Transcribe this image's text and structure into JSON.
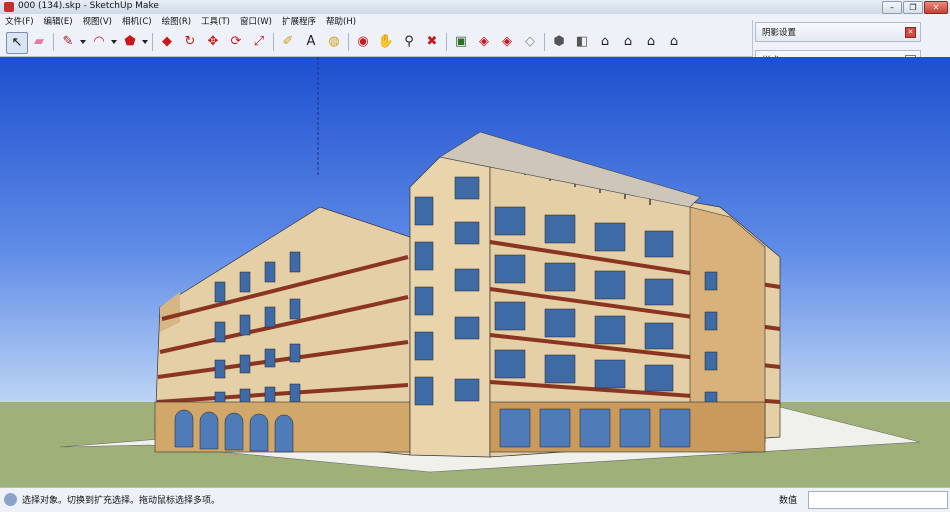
{
  "window": {
    "title": "000 (134).skp - SketchUp Make",
    "minimize_glyph": "–",
    "maximize_glyph": "❐",
    "close_glyph": "✕"
  },
  "menu": [
    "文件(F)",
    "编辑(E)",
    "视图(V)",
    "相机(C)",
    "绘图(R)",
    "工具(T)",
    "窗口(W)",
    "扩展程序",
    "帮助(H)"
  ],
  "toolbar": {
    "tools": [
      {
        "name": "select-icon",
        "glyph": "↖",
        "color": "#111111",
        "active": true
      },
      {
        "name": "eraser-icon",
        "glyph": "▰",
        "color": "#e27aa2"
      },
      {
        "name": "pencil-icon",
        "glyph": "✎",
        "color": "#b0131a",
        "dropdown": true
      },
      {
        "name": "arc-icon",
        "glyph": "◠",
        "color": "#c8191f",
        "dropdown": true
      },
      {
        "name": "shape-icon",
        "glyph": "⬟",
        "color": "#c8191f",
        "dropdown": true
      },
      {
        "name": "push-pull-icon",
        "glyph": "◆",
        "color": "#c8191f"
      },
      {
        "name": "follow-me-icon",
        "glyph": "↻",
        "color": "#c8191f"
      },
      {
        "name": "move-icon",
        "glyph": "✥",
        "color": "#c8191f"
      },
      {
        "name": "rotate-icon",
        "glyph": "⟳",
        "color": "#c8191f"
      },
      {
        "name": "scale-icon",
        "glyph": "⤢",
        "color": "#c8191f"
      },
      {
        "name": "tape-measure-icon",
        "glyph": "✐",
        "color": "#c9a21b"
      },
      {
        "name": "text-icon",
        "glyph": "A",
        "color": "#222222"
      },
      {
        "name": "paint-bucket-icon",
        "glyph": "◍",
        "color": "#c9a21b"
      },
      {
        "name": "orbit-icon",
        "glyph": "◉",
        "color": "#c8191f"
      },
      {
        "name": "pan-icon",
        "glyph": "✋",
        "color": "#444444"
      },
      {
        "name": "zoom-icon",
        "glyph": "⚲",
        "color": "#222222"
      },
      {
        "name": "zoom-extents-icon",
        "glyph": "✖",
        "color": "#c8191f"
      },
      {
        "name": "warehouse-icon",
        "glyph": "▣",
        "color": "#2f6b2f"
      },
      {
        "name": "share-model-icon",
        "glyph": "◈",
        "color": "#c8191f"
      },
      {
        "name": "component-share-icon",
        "glyph": "◈",
        "color": "#c8191f"
      },
      {
        "name": "extension-warehouse-icon",
        "glyph": "◇",
        "color": "#888888"
      },
      {
        "name": "iso-view-icon",
        "glyph": "⬢",
        "color": "#555555"
      },
      {
        "name": "top-view-icon",
        "glyph": "◧",
        "color": "#555555"
      },
      {
        "name": "front-view-icon",
        "glyph": "⌂",
        "color": "#222222"
      },
      {
        "name": "right-view-icon",
        "glyph": "⌂",
        "color": "#222222"
      },
      {
        "name": "back-view-icon",
        "glyph": "⌂",
        "color": "#222222"
      },
      {
        "name": "left-view-icon",
        "glyph": "⌂",
        "color": "#222222"
      }
    ]
  },
  "tray": {
    "shadow_panel": "阴影设置",
    "style_panel": "样式",
    "close_glyph": "✕",
    "expand_glyph": "▢"
  },
  "status": {
    "hint": "选择对象。切换到扩充选择。拖动鼠标选择多项。",
    "value_label": "数值",
    "value": ""
  },
  "colors": {
    "sky_top": "#1d4fcf",
    "ground": "#9fb179",
    "wall_beige": "#e3cda4",
    "wall_tan": "#d2a86a",
    "stripe_brown": "#8a3522",
    "glass": "#3e6aa6"
  }
}
